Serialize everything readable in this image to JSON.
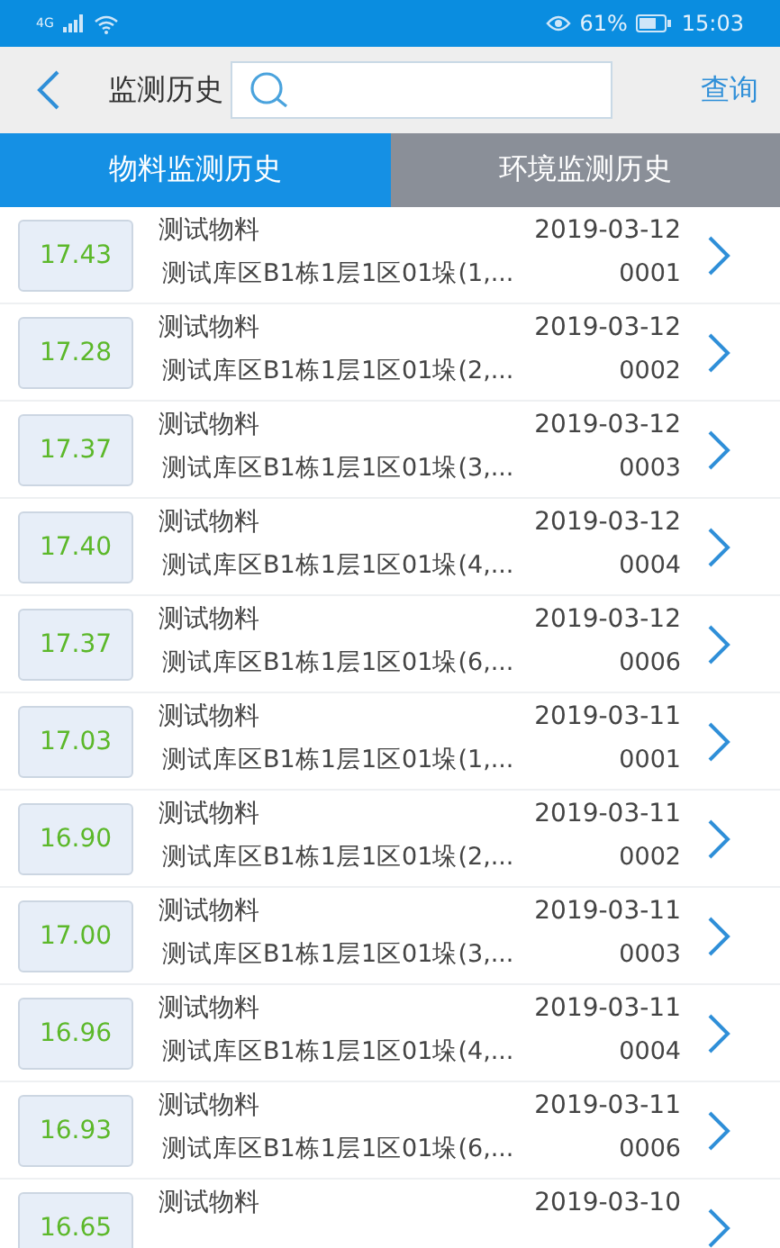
{
  "status_bar": {
    "network": "4G",
    "battery": "61%",
    "time": "15:03"
  },
  "header": {
    "title": "监测历史",
    "action": "查询"
  },
  "tabs": [
    {
      "label": "物料监测历史",
      "selected": true
    },
    {
      "label": "环境监测历史",
      "selected": false
    }
  ],
  "records": [
    {
      "value": "17.43",
      "name": "测试物料",
      "date": "2019-03-12",
      "location": "测试库区B1栋1层1区01垛(1,...",
      "code": "0001"
    },
    {
      "value": "17.28",
      "name": "测试物料",
      "date": "2019-03-12",
      "location": "测试库区B1栋1层1区01垛(2,...",
      "code": "0002"
    },
    {
      "value": "17.37",
      "name": "测试物料",
      "date": "2019-03-12",
      "location": "测试库区B1栋1层1区01垛(3,...",
      "code": "0003"
    },
    {
      "value": "17.40",
      "name": "测试物料",
      "date": "2019-03-12",
      "location": "测试库区B1栋1层1区01垛(4,...",
      "code": "0004"
    },
    {
      "value": "17.37",
      "name": "测试物料",
      "date": "2019-03-12",
      "location": "测试库区B1栋1层1区01垛(6,...",
      "code": "0006"
    },
    {
      "value": "17.03",
      "name": "测试物料",
      "date": "2019-03-11",
      "location": "测试库区B1栋1层1区01垛(1,...",
      "code": "0001"
    },
    {
      "value": "16.90",
      "name": "测试物料",
      "date": "2019-03-11",
      "location": "测试库区B1栋1层1区01垛(2,...",
      "code": "0002"
    },
    {
      "value": "17.00",
      "name": "测试物料",
      "date": "2019-03-11",
      "location": "测试库区B1栋1层1区01垛(3,...",
      "code": "0003"
    },
    {
      "value": "16.96",
      "name": "测试物料",
      "date": "2019-03-11",
      "location": "测试库区B1栋1层1区01垛(4,...",
      "code": "0004"
    },
    {
      "value": "16.93",
      "name": "测试物料",
      "date": "2019-03-11",
      "location": "测试库区B1栋1层1区01垛(6,...",
      "code": "0006"
    },
    {
      "value": "16.65",
      "name": "测试物料",
      "date": "2019-03-10"
    }
  ]
}
